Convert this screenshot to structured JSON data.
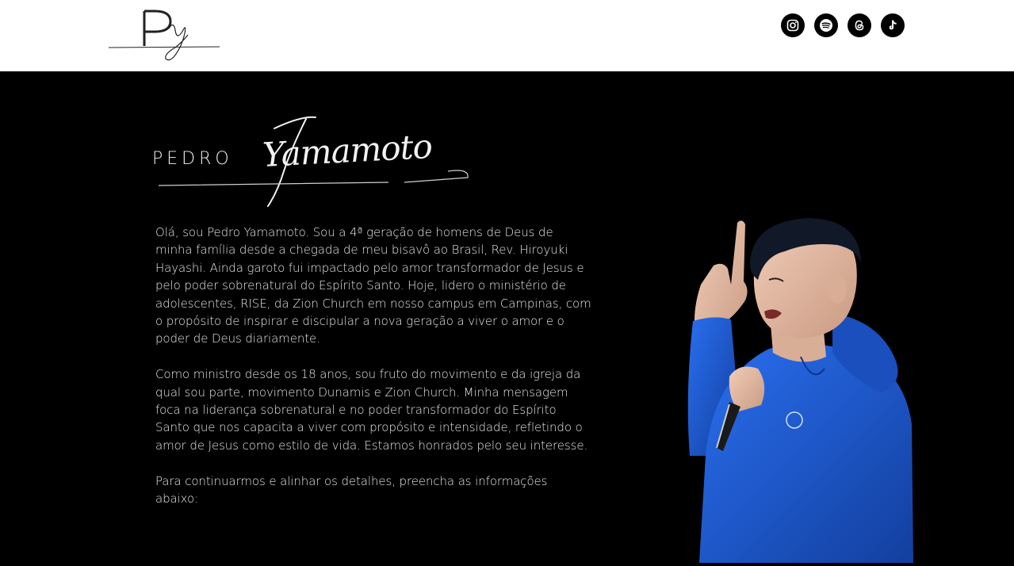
{
  "header": {
    "logo_alt": "PY",
    "social": [
      {
        "name": "instagram",
        "icon": "instagram-icon"
      },
      {
        "name": "spotify",
        "icon": "spotify-icon"
      },
      {
        "name": "threads",
        "icon": "threads-icon"
      },
      {
        "name": "tiktok",
        "icon": "tiktok-icon"
      }
    ]
  },
  "hero": {
    "name_first": "PEDRO",
    "name_last": "Yamamoto",
    "paragraphs": [
      "Olá, sou Pedro Yamamoto. Sou a 4ª geração de homens de Deus de minha família desde a chegada de meu bisavô ao Brasil, Rev. Hiroyuki Hayashi. Ainda garoto fui impactado pelo amor transformador de Jesus e pelo poder sobrenatural do Espírito Santo. Hoje, lidero o ministério de adolescentes, RISE, da Zion Church em nosso campus em Campinas, com o propósito de inspirar e discipular a nova geração a viver o amor e o poder de Deus diariamente.",
      "Como ministro desde os 18 anos, sou fruto do movimento e da igreja da qual sou parte, movimento Dunamis e Zion Church. Minha mensagem foca na liderança sobrenatural e no poder transformador do Espírito Santo que nos capacita a viver com propósito e intensidade, refletindo o amor de Jesus como estilo de vida. Estamos honrados pelo seu interesse.",
      "Para continuarmos e alinhar os detalhes, preencha as informações abaixo:"
    ]
  },
  "colors": {
    "header_bg": "#ffffff",
    "page_bg": "#000000",
    "text": "#e6e6e6",
    "hoodie": "#1f5fd6"
  }
}
